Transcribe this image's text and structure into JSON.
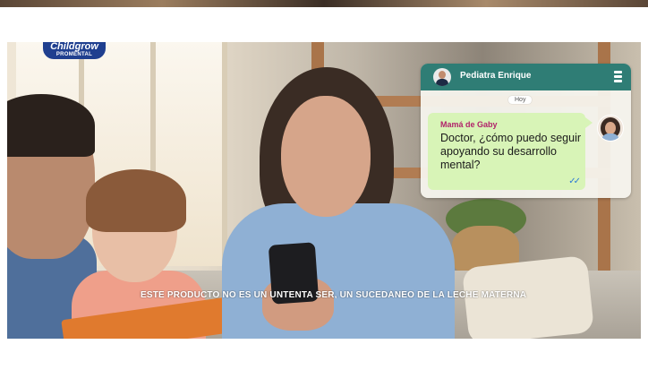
{
  "brand": {
    "logo_text": "Childgrow",
    "logo_sub": "PROMENTAL"
  },
  "chat": {
    "header_title": "Pediatra Enrique",
    "date_label": "Hoy",
    "message": {
      "sender": "Mamá de Gaby",
      "text": "Doctor, ¿cómo puedo seguir apoyando su desarrollo mental?",
      "status": "✓✓"
    }
  },
  "disclaimer": "ESTE PRODUCTO NO ES UN UNTENTA SER, UN SUCEDÁNEO DE LA LECHE MATERNA",
  "colors": {
    "chat_header": "#2f7d75",
    "bubble": "#d8f4b7",
    "sender": "#b1236a",
    "read_ticks": "#2d7bd6"
  },
  "icons": [
    "doctor-avatar-icon",
    "menu-icon",
    "read-receipt-icon",
    "mother-avatar-icon"
  ]
}
